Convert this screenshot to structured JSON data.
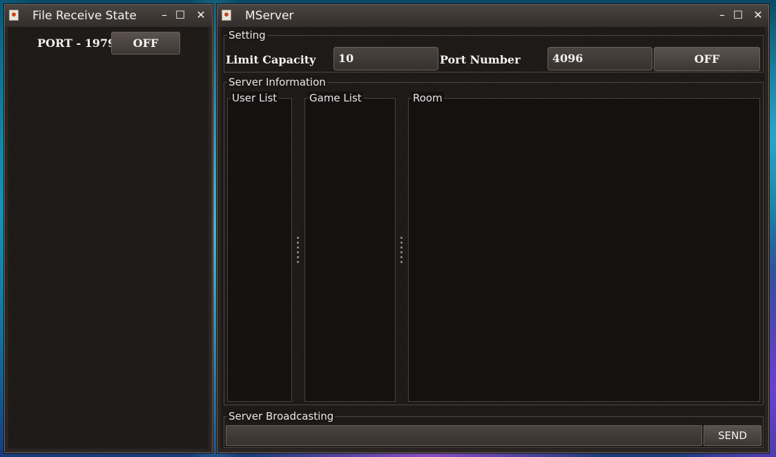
{
  "file_receive_window": {
    "title": "File Receive State",
    "controls": {
      "minimize": "–",
      "maximize": "☐",
      "close": "✕"
    },
    "port_label": "PORT - 1979",
    "toggle_label": "OFF"
  },
  "mserver_window": {
    "title": "MServer",
    "controls": {
      "minimize": "–",
      "maximize": "☐",
      "close": "✕"
    },
    "setting": {
      "legend": "Setting",
      "limit_capacity_label": "Limit Capacity",
      "limit_capacity_value": "10",
      "port_number_label": "Port Number",
      "port_number_value": "4096",
      "toggle_label": "OFF"
    },
    "server_information": {
      "legend": "Server Information",
      "user_list_label": "User List",
      "game_list_label": "Game List",
      "room_label": "Room"
    },
    "broadcast": {
      "legend": "Server Broadcasting",
      "input_value": "",
      "send_label": "SEND"
    }
  }
}
